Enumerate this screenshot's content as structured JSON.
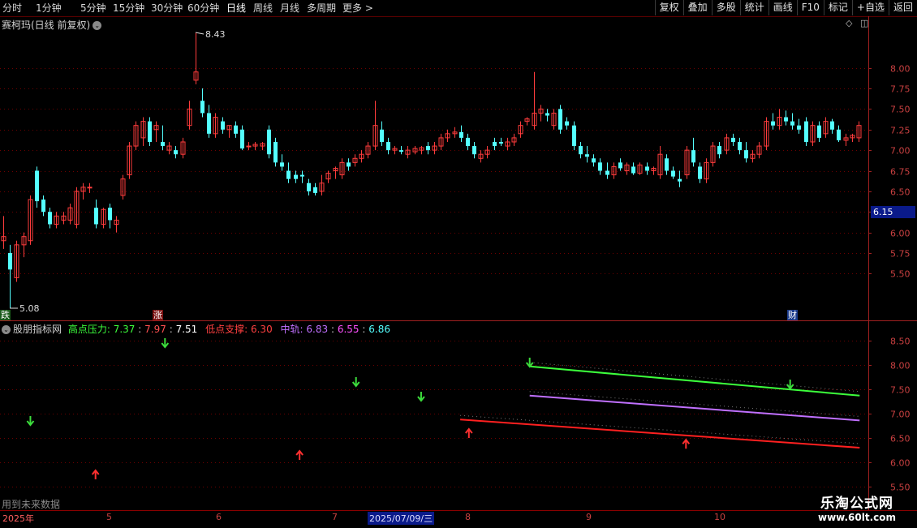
{
  "toolbar": {
    "periods": [
      "分时",
      "1分钟",
      "5分钟",
      "15分钟",
      "30分钟",
      "60分钟",
      "日线",
      "周线",
      "月线",
      "多周期",
      "更多 >"
    ],
    "active_period": "日线",
    "actions": [
      "复权",
      "叠加",
      "多股",
      "统计",
      "画线",
      "F10",
      "标记",
      "+自选",
      "返回"
    ]
  },
  "main_chart": {
    "title": "赛柯玛(日线 前复权)",
    "current_price_tag": "6.15",
    "high_label": "8.43",
    "low_label": "5.08",
    "badges": {
      "left": "跌",
      "mid": "涨",
      "right": "财"
    }
  },
  "indicator": {
    "name": "股朋指标网",
    "high_label": "高点压力:",
    "high_values": [
      "7.37",
      "7.97",
      "7.51"
    ],
    "low_label": "低点支撑:",
    "low_value": "6.30",
    "mid_label": "中轨:",
    "mid_values": [
      "6.83",
      "6.55",
      "6.86"
    ]
  },
  "footer": {
    "future_data": "用到未来数据",
    "watermark_title": "乐淘公式网",
    "watermark_url": "www.60lt.com",
    "time_labels": [
      "2025年",
      "5",
      "6",
      "7",
      "2025/07/09/三",
      "8",
      "9",
      "10"
    ]
  },
  "colors": {
    "up": "#ff3c3c",
    "down": "#54ffff",
    "grid": "#6b0000",
    "axis": "#a02020",
    "high_line": "#3cff3c",
    "mid_line": "#c070ff",
    "low_line": "#ff2020"
  },
  "chart_data": [
    {
      "type": "candlestick",
      "title": "赛柯玛(日线 前复权)",
      "y_ticks": [
        8.0,
        7.75,
        7.5,
        7.25,
        7.0,
        6.75,
        6.5,
        6.25,
        6.0,
        5.75,
        5.5
      ],
      "ylim": [
        5.08,
        8.43
      ],
      "x_ticks": [
        "2025年",
        "5",
        "6",
        "7",
        "8",
        "9",
        "10"
      ],
      "candles": [
        {
          "o": 5.9,
          "h": 6.2,
          "l": 5.8,
          "c": 5.95
        },
        {
          "o": 5.75,
          "h": 5.85,
          "l": 5.08,
          "c": 5.55
        },
        {
          "o": 5.45,
          "h": 5.9,
          "l": 5.4,
          "c": 5.85
        },
        {
          "o": 5.85,
          "h": 6.0,
          "l": 5.7,
          "c": 5.95
        },
        {
          "o": 5.9,
          "h": 6.45,
          "l": 5.85,
          "c": 6.4
        },
        {
          "o": 6.75,
          "h": 6.8,
          "l": 6.3,
          "c": 6.38
        },
        {
          "o": 6.4,
          "h": 6.45,
          "l": 6.2,
          "c": 6.25
        },
        {
          "o": 6.25,
          "h": 6.3,
          "l": 6.05,
          "c": 6.1
        },
        {
          "o": 6.1,
          "h": 6.25,
          "l": 6.05,
          "c": 6.2
        },
        {
          "o": 6.15,
          "h": 6.25,
          "l": 6.1,
          "c": 6.2
        },
        {
          "o": 6.15,
          "h": 6.35,
          "l": 6.1,
          "c": 6.3
        },
        {
          "o": 6.1,
          "h": 6.55,
          "l": 6.05,
          "c": 6.5
        },
        {
          "o": 6.5,
          "h": 6.6,
          "l": 6.4,
          "c": 6.55
        },
        {
          "o": 6.55,
          "h": 6.6,
          "l": 6.48,
          "c": 6.55
        },
        {
          "o": 6.3,
          "h": 6.4,
          "l": 6.05,
          "c": 6.1
        },
        {
          "o": 6.1,
          "h": 6.3,
          "l": 6.05,
          "c": 6.28
        },
        {
          "o": 6.3,
          "h": 6.35,
          "l": 6.05,
          "c": 6.15
        },
        {
          "o": 6.1,
          "h": 6.2,
          "l": 6.0,
          "c": 6.15
        },
        {
          "o": 6.45,
          "h": 6.7,
          "l": 6.4,
          "c": 6.65
        },
        {
          "o": 6.7,
          "h": 7.1,
          "l": 6.65,
          "c": 7.05
        },
        {
          "o": 7.05,
          "h": 7.35,
          "l": 7.0,
          "c": 7.3
        },
        {
          "o": 7.15,
          "h": 7.4,
          "l": 7.05,
          "c": 7.35
        },
        {
          "o": 7.35,
          "h": 7.4,
          "l": 7.05,
          "c": 7.1
        },
        {
          "o": 7.25,
          "h": 7.35,
          "l": 7.1,
          "c": 7.3
        },
        {
          "o": 7.1,
          "h": 7.3,
          "l": 7.0,
          "c": 7.05
        },
        {
          "o": 7.0,
          "h": 7.1,
          "l": 6.95,
          "c": 7.05
        },
        {
          "o": 7.0,
          "h": 7.05,
          "l": 6.9,
          "c": 6.95
        },
        {
          "o": 6.95,
          "h": 7.15,
          "l": 6.9,
          "c": 7.1
        },
        {
          "o": 7.3,
          "h": 7.6,
          "l": 7.25,
          "c": 7.5
        },
        {
          "o": 7.85,
          "h": 8.43,
          "l": 7.8,
          "c": 7.95
        },
        {
          "o": 7.6,
          "h": 7.75,
          "l": 7.4,
          "c": 7.45
        },
        {
          "o": 7.45,
          "h": 7.55,
          "l": 7.15,
          "c": 7.2
        },
        {
          "o": 7.2,
          "h": 7.45,
          "l": 7.15,
          "c": 7.4
        },
        {
          "o": 7.35,
          "h": 7.4,
          "l": 7.2,
          "c": 7.25
        },
        {
          "o": 7.25,
          "h": 7.3,
          "l": 7.15,
          "c": 7.3
        },
        {
          "o": 7.3,
          "h": 7.35,
          "l": 7.15,
          "c": 7.2
        },
        {
          "o": 7.25,
          "h": 7.3,
          "l": 7.0,
          "c": 7.02
        },
        {
          "o": 7.05,
          "h": 7.1,
          "l": 7.0,
          "c": 7.05
        },
        {
          "o": 7.05,
          "h": 7.1,
          "l": 7.0,
          "c": 7.07
        },
        {
          "o": 7.05,
          "h": 7.1,
          "l": 7.0,
          "c": 7.08
        },
        {
          "o": 7.25,
          "h": 7.3,
          "l": 6.9,
          "c": 6.95
        },
        {
          "o": 7.1,
          "h": 7.15,
          "l": 6.8,
          "c": 6.85
        },
        {
          "o": 6.85,
          "h": 6.95,
          "l": 6.75,
          "c": 6.8
        },
        {
          "o": 6.75,
          "h": 6.85,
          "l": 6.6,
          "c": 6.65
        },
        {
          "o": 6.7,
          "h": 6.75,
          "l": 6.6,
          "c": 6.65
        },
        {
          "o": 6.7,
          "h": 6.75,
          "l": 6.6,
          "c": 6.68
        },
        {
          "o": 6.6,
          "h": 6.65,
          "l": 6.45,
          "c": 6.5
        },
        {
          "o": 6.55,
          "h": 6.6,
          "l": 6.45,
          "c": 6.48
        },
        {
          "o": 6.5,
          "h": 6.7,
          "l": 6.45,
          "c": 6.6
        },
        {
          "o": 6.65,
          "h": 6.75,
          "l": 6.6,
          "c": 6.72
        },
        {
          "o": 6.75,
          "h": 6.8,
          "l": 6.65,
          "c": 6.78
        },
        {
          "o": 6.7,
          "h": 6.9,
          "l": 6.65,
          "c": 6.85
        },
        {
          "o": 6.85,
          "h": 6.9,
          "l": 6.75,
          "c": 6.8
        },
        {
          "o": 6.85,
          "h": 6.95,
          "l": 6.8,
          "c": 6.9
        },
        {
          "o": 6.9,
          "h": 7.0,
          "l": 6.85,
          "c": 6.95
        },
        {
          "o": 6.95,
          "h": 7.1,
          "l": 6.9,
          "c": 7.05
        },
        {
          "o": 7.05,
          "h": 7.6,
          "l": 7.0,
          "c": 7.3
        },
        {
          "o": 7.25,
          "h": 7.35,
          "l": 7.05,
          "c": 7.1
        },
        {
          "o": 7.1,
          "h": 7.15,
          "l": 6.95,
          "c": 7.0
        },
        {
          "o": 7.0,
          "h": 7.05,
          "l": 6.95,
          "c": 7.02
        },
        {
          "o": 7.0,
          "h": 7.05,
          "l": 6.95,
          "c": 6.98
        },
        {
          "o": 6.95,
          "h": 7.05,
          "l": 6.9,
          "c": 7.0
        },
        {
          "o": 6.98,
          "h": 7.05,
          "l": 6.95,
          "c": 7.02
        },
        {
          "o": 7.0,
          "h": 7.05,
          "l": 6.95,
          "c": 7.03
        },
        {
          "o": 7.05,
          "h": 7.1,
          "l": 6.95,
          "c": 7.0
        },
        {
          "o": 7.0,
          "h": 7.1,
          "l": 6.95,
          "c": 7.05
        },
        {
          "o": 7.05,
          "h": 7.2,
          "l": 7.0,
          "c": 7.15
        },
        {
          "o": 7.15,
          "h": 7.25,
          "l": 7.1,
          "c": 7.2
        },
        {
          "o": 7.2,
          "h": 7.28,
          "l": 7.15,
          "c": 7.22
        },
        {
          "o": 7.22,
          "h": 7.3,
          "l": 7.1,
          "c": 7.15
        },
        {
          "o": 7.15,
          "h": 7.2,
          "l": 7.0,
          "c": 7.05
        },
        {
          "o": 7.05,
          "h": 7.1,
          "l": 6.9,
          "c": 6.95
        },
        {
          "o": 6.9,
          "h": 7.0,
          "l": 6.85,
          "c": 6.95
        },
        {
          "o": 6.95,
          "h": 7.05,
          "l": 6.9,
          "c": 7.0
        },
        {
          "o": 7.1,
          "h": 7.15,
          "l": 7.0,
          "c": 7.05
        },
        {
          "o": 7.1,
          "h": 7.15,
          "l": 7.05,
          "c": 7.08
        },
        {
          "o": 7.05,
          "h": 7.15,
          "l": 7.0,
          "c": 7.1
        },
        {
          "o": 7.1,
          "h": 7.2,
          "l": 7.05,
          "c": 7.15
        },
        {
          "o": 7.2,
          "h": 7.35,
          "l": 7.15,
          "c": 7.3
        },
        {
          "o": 7.35,
          "h": 7.4,
          "l": 7.3,
          "c": 7.38
        },
        {
          "o": 7.3,
          "h": 7.95,
          "l": 7.25,
          "c": 7.45
        },
        {
          "o": 7.45,
          "h": 7.55,
          "l": 7.35,
          "c": 7.5
        },
        {
          "o": 7.45,
          "h": 7.5,
          "l": 7.35,
          "c": 7.42
        },
        {
          "o": 7.3,
          "h": 7.5,
          "l": 7.25,
          "c": 7.45
        },
        {
          "o": 7.5,
          "h": 7.55,
          "l": 7.2,
          "c": 7.25
        },
        {
          "o": 7.35,
          "h": 7.4,
          "l": 7.25,
          "c": 7.3
        },
        {
          "o": 7.3,
          "h": 7.35,
          "l": 7.0,
          "c": 7.05
        },
        {
          "o": 7.05,
          "h": 7.1,
          "l": 6.9,
          "c": 6.95
        },
        {
          "o": 6.95,
          "h": 7.05,
          "l": 6.85,
          "c": 6.92
        },
        {
          "o": 6.9,
          "h": 6.95,
          "l": 6.8,
          "c": 6.85
        },
        {
          "o": 6.85,
          "h": 6.9,
          "l": 6.7,
          "c": 6.75
        },
        {
          "o": 6.75,
          "h": 6.85,
          "l": 6.65,
          "c": 6.7
        },
        {
          "o": 6.7,
          "h": 6.85,
          "l": 6.65,
          "c": 6.8
        },
        {
          "o": 6.85,
          "h": 6.9,
          "l": 6.75,
          "c": 6.78
        },
        {
          "o": 6.75,
          "h": 6.85,
          "l": 6.7,
          "c": 6.82
        },
        {
          "o": 6.8,
          "h": 6.85,
          "l": 6.7,
          "c": 6.72
        },
        {
          "o": 6.72,
          "h": 6.85,
          "l": 6.7,
          "c": 6.82
        },
        {
          "o": 6.8,
          "h": 6.85,
          "l": 6.7,
          "c": 6.75
        },
        {
          "o": 6.75,
          "h": 6.8,
          "l": 6.7,
          "c": 6.78
        },
        {
          "o": 6.7,
          "h": 7.05,
          "l": 6.65,
          "c": 6.95
        },
        {
          "o": 6.9,
          "h": 6.95,
          "l": 6.7,
          "c": 6.75
        },
        {
          "o": 6.75,
          "h": 6.8,
          "l": 6.65,
          "c": 6.68
        },
        {
          "o": 6.65,
          "h": 6.75,
          "l": 6.55,
          "c": 6.62
        },
        {
          "o": 6.7,
          "h": 7.05,
          "l": 6.65,
          "c": 7.0
        },
        {
          "o": 7.0,
          "h": 7.15,
          "l": 6.8,
          "c": 6.85
        },
        {
          "o": 6.8,
          "h": 6.85,
          "l": 6.6,
          "c": 6.65
        },
        {
          "o": 6.65,
          "h": 6.9,
          "l": 6.6,
          "c": 6.85
        },
        {
          "o": 6.85,
          "h": 7.1,
          "l": 6.8,
          "c": 7.05
        },
        {
          "o": 7.05,
          "h": 7.1,
          "l": 6.9,
          "c": 6.95
        },
        {
          "o": 7.0,
          "h": 7.2,
          "l": 6.95,
          "c": 7.15
        },
        {
          "o": 7.15,
          "h": 7.2,
          "l": 7.05,
          "c": 7.1
        },
        {
          "o": 7.1,
          "h": 7.15,
          "l": 6.95,
          "c": 7.0
        },
        {
          "o": 7.0,
          "h": 7.1,
          "l": 6.85,
          "c": 6.9
        },
        {
          "o": 6.9,
          "h": 7.0,
          "l": 6.85,
          "c": 6.95
        },
        {
          "o": 6.95,
          "h": 7.1,
          "l": 6.9,
          "c": 7.05
        },
        {
          "o": 7.05,
          "h": 7.4,
          "l": 7.0,
          "c": 7.35
        },
        {
          "o": 7.35,
          "h": 7.45,
          "l": 7.25,
          "c": 7.3
        },
        {
          "o": 7.3,
          "h": 7.5,
          "l": 7.25,
          "c": 7.4
        },
        {
          "o": 7.4,
          "h": 7.48,
          "l": 7.3,
          "c": 7.35
        },
        {
          "o": 7.35,
          "h": 7.45,
          "l": 7.25,
          "c": 7.3
        },
        {
          "o": 7.3,
          "h": 7.38,
          "l": 7.2,
          "c": 7.25
        },
        {
          "o": 7.35,
          "h": 7.4,
          "l": 7.05,
          "c": 7.1
        },
        {
          "o": 7.1,
          "h": 7.35,
          "l": 7.05,
          "c": 7.3
        },
        {
          "o": 7.3,
          "h": 7.35,
          "l": 7.1,
          "c": 7.15
        },
        {
          "o": 7.2,
          "h": 7.4,
          "l": 7.15,
          "c": 7.35
        },
        {
          "o": 7.35,
          "h": 7.38,
          "l": 7.2,
          "c": 7.25
        },
        {
          "o": 7.25,
          "h": 7.3,
          "l": 7.1,
          "c": 7.12
        },
        {
          "o": 7.12,
          "h": 7.2,
          "l": 7.05,
          "c": 7.15
        },
        {
          "o": 7.15,
          "h": 7.2,
          "l": 7.1,
          "c": 7.18
        },
        {
          "o": 7.15,
          "h": 7.35,
          "l": 7.1,
          "c": 7.3
        }
      ]
    },
    {
      "type": "line",
      "title": "股朋指标网",
      "y_ticks": [
        8.5,
        8.0,
        7.5,
        7.0,
        6.5,
        6.0,
        5.5
      ],
      "ylim": [
        5.5,
        8.7
      ],
      "series": [
        {
          "name": "高点压力",
          "x_range": [
            0.61,
            0.99
          ],
          "values": [
            7.97,
            7.37
          ]
        },
        {
          "name": "中轨",
          "x_range": [
            0.61,
            0.99
          ],
          "values": [
            7.37,
            6.86
          ]
        },
        {
          "name": "低点支撑",
          "x_range": [
            0.53,
            0.99
          ],
          "values": [
            6.88,
            6.3
          ]
        }
      ],
      "down_arrows": [
        {
          "x": 0.035,
          "y": 6.85
        },
        {
          "x": 0.19,
          "y": 8.45
        },
        {
          "x": 0.41,
          "y": 7.65
        },
        {
          "x": 0.485,
          "y": 7.35
        },
        {
          "x": 0.61,
          "y": 8.05
        },
        {
          "x": 0.91,
          "y": 7.6
        }
      ],
      "up_arrows": [
        {
          "x": 0.11,
          "y": 5.75
        },
        {
          "x": 0.345,
          "y": 6.15
        },
        {
          "x": 0.54,
          "y": 6.6
        },
        {
          "x": 0.79,
          "y": 6.38
        }
      ]
    }
  ]
}
